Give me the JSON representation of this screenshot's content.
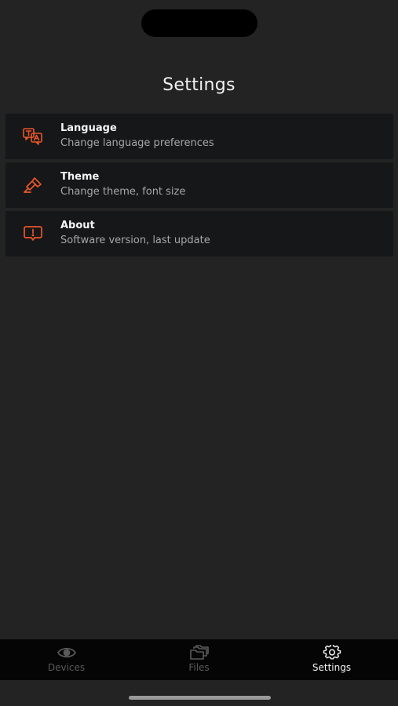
{
  "header": {
    "title": "Settings"
  },
  "settings": {
    "items": [
      {
        "title": "Language",
        "subtitle": "Change language preferences",
        "icon": "translate-icon"
      },
      {
        "title": "Theme",
        "subtitle": "Change theme, font size",
        "icon": "paintbrush-icon"
      },
      {
        "title": "About",
        "subtitle": "Software version, last update",
        "icon": "info-alert-icon"
      }
    ]
  },
  "tabbar": {
    "tabs": [
      {
        "label": "Devices",
        "icon": "eye-icon",
        "active": false
      },
      {
        "label": "Files",
        "icon": "folders-icon",
        "active": false
      },
      {
        "label": "Settings",
        "icon": "gear-icon",
        "active": true
      }
    ]
  },
  "colors": {
    "background": "#232323",
    "card": "#161718",
    "accent": "#e8572a",
    "tabbar": "#050505",
    "inactive": "#5a5a5a"
  }
}
